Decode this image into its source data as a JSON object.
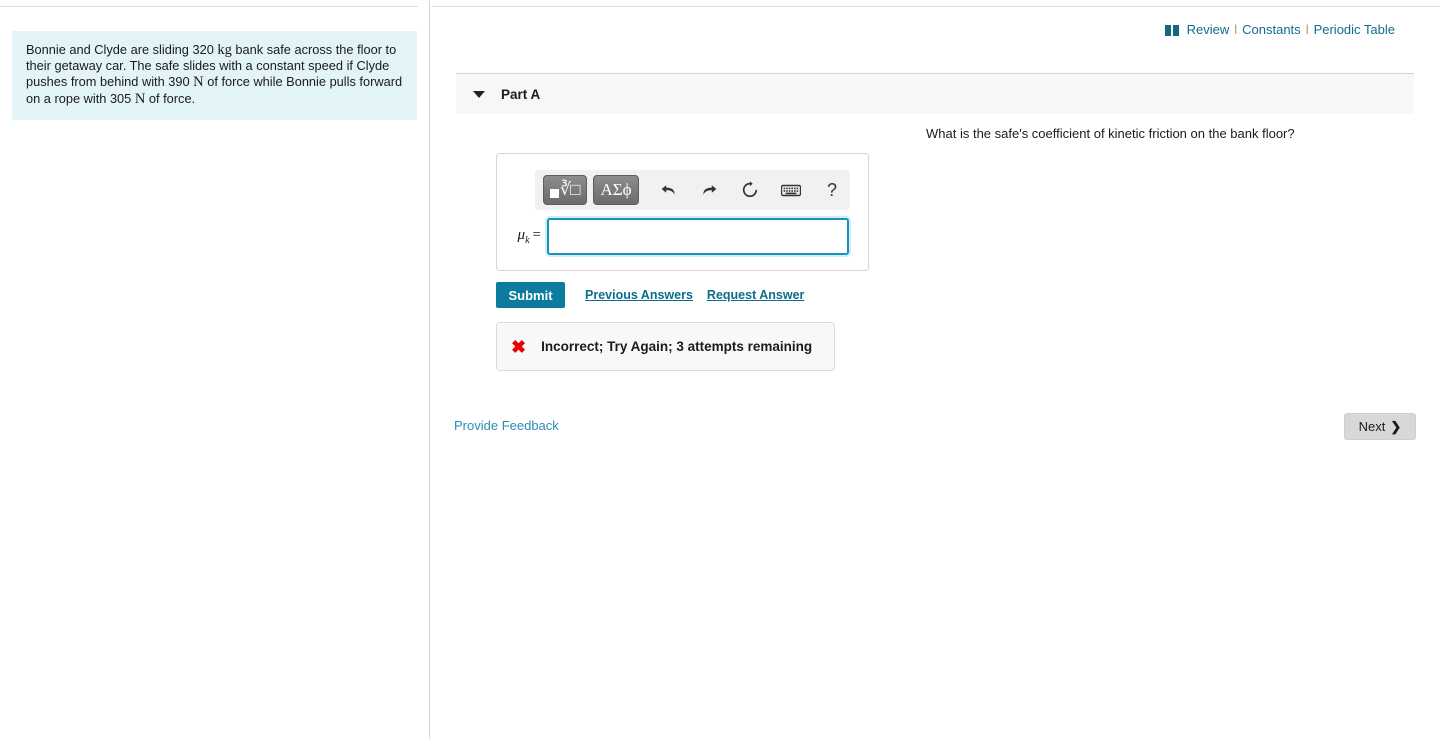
{
  "utility_bar": {
    "book_icon": "book-icon",
    "links": [
      {
        "label": "Review"
      },
      {
        "label": "Constants"
      },
      {
        "label": "Periodic Table"
      }
    ],
    "separator": "l",
    "link_color": "#0e6e8c"
  },
  "problem": {
    "text_part_1": "Bonnie and Clyde are sliding 320 ",
    "unit_1": "kg",
    "text_part_2": " bank safe across the floor to their getaway car. The safe slides with a constant speed if Clyde pushes from behind with 390 ",
    "unit_2": "N",
    "text_part_3": " of force while Bonnie pulls forward on a rope with 305 ",
    "unit_3": "N",
    "text_part_4": " of force.",
    "background_color": "#e3f4f8"
  },
  "part": {
    "label": "Part A",
    "caret_icon": "caret-down-icon",
    "question": "What is the safe's coefficient of kinetic friction on the bank floor?"
  },
  "answer": {
    "toolbar": {
      "math_template_button": "√",
      "greek_button": "ΑΣϕ",
      "undo_icon": "⬅",
      "redo_icon": "➡",
      "reset_icon": "↻",
      "keyboard_icon": "⌨",
      "help_icon": "?"
    },
    "variable_symbol": "μ",
    "variable_subscript": "k",
    "equals": "=",
    "value": "",
    "placeholder": "",
    "border_color": "#1a93b8"
  },
  "actions": {
    "submit_label": "Submit",
    "submit_color": "#0d7b9e",
    "previous_answers_label": "Previous Answers",
    "request_answer_label": "Request Answer"
  },
  "feedback": {
    "icon": "red-x-icon",
    "icon_glyph": "✖",
    "icon_color": "#e60000",
    "message": "Incorrect; Try Again; 3 attempts remaining"
  },
  "footer": {
    "provide_feedback_label": "Provide Feedback",
    "next_label": "Next",
    "next_chevron": "❯"
  }
}
